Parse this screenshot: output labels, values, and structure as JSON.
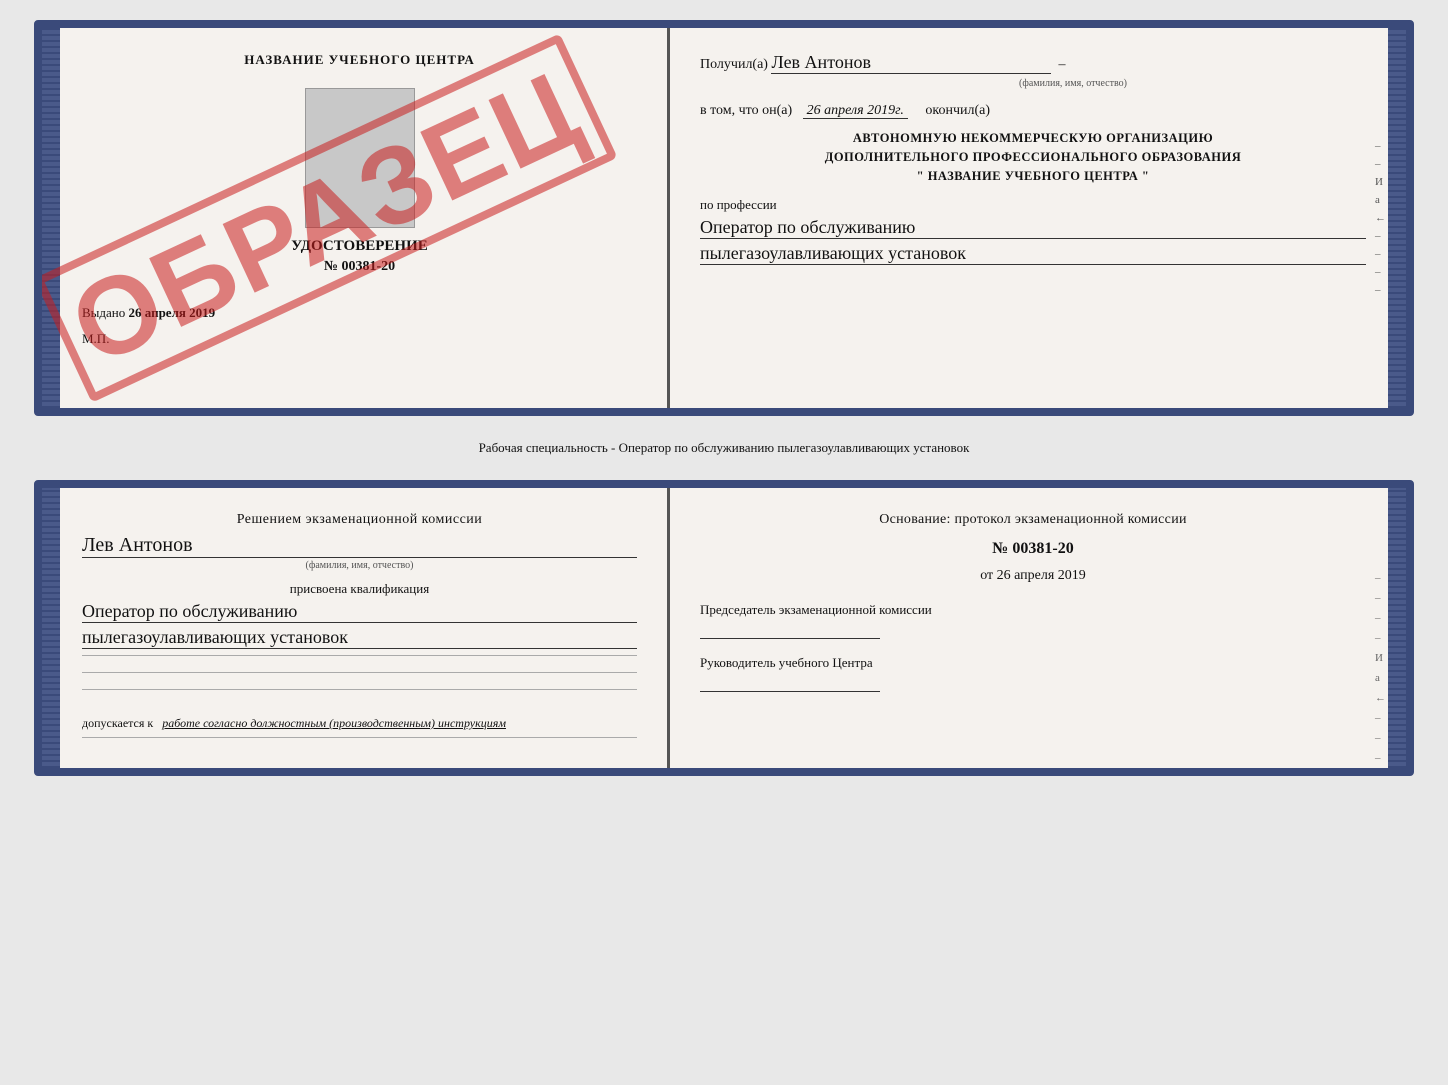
{
  "page": {
    "bg_color": "#e8e8e8"
  },
  "top_section": {
    "left": {
      "title": "НАЗВАНИЕ УЧЕБНОГО ЦЕНТРА",
      "watermark": "ОБРАЗЕЦ",
      "cert_title": "УДОСТОВЕРЕНИЕ",
      "cert_number": "№ 00381-20",
      "issued_label": "Выдано",
      "issued_date": "26 апреля 2019",
      "mp": "М.П."
    },
    "right": {
      "received_label": "Получил(а)",
      "received_name": "Лев Антонов",
      "fio_label": "(фамилия, имя, отчество)",
      "date_prefix": "в том, что он(а)",
      "date_value": "26 апреля 2019г.",
      "date_suffix": "окончил(а)",
      "org_line1": "АВТОНОМНУЮ НЕКОММЕРЧЕСКУЮ ОРГАНИЗАЦИЮ",
      "org_line2": "ДОПОЛНИТЕЛЬНОГО ПРОФЕССИОНАЛЬНОГО ОБРАЗОВАНИЯ",
      "org_line3": "\"   НАЗВАНИЕ УЧЕБНОГО ЦЕНТРА   \"",
      "profession_label": "по профессии",
      "profession_line1": "Оператор по обслуживанию",
      "profession_line2": "пылегазоулавливающих установок",
      "side_marks": [
        "–",
        "–",
        "И",
        "а",
        "←",
        "–",
        "–",
        "–",
        "–"
      ]
    }
  },
  "middle_text": "Рабочая специальность - Оператор по обслуживанию пылегазоулавливающих установок",
  "bottom_section": {
    "left": {
      "decision_title": "Решением экзаменационной комиссии",
      "person_name": "Лев Антонов",
      "fio_label": "(фамилия, имя, отчество)",
      "qualification_label": "присвоена квалификация",
      "qualification_line1": "Оператор по обслуживанию",
      "qualification_line2": "пылегазоулавливающих установок",
      "blank_lines": [
        "",
        "",
        ""
      ],
      "allowed_label": "допускается к",
      "allowed_value": "работе согласно должностным (производственным) инструкциям"
    },
    "right": {
      "foundation_label": "Основание: протокол экзаменационной комиссии",
      "protocol_number": "№  00381-20",
      "protocol_date_prefix": "от",
      "protocol_date": "26 апреля 2019",
      "chairman_label": "Председатель экзаменационной комиссии",
      "director_label": "Руководитель учебного Центра",
      "side_marks": [
        "–",
        "–",
        "–",
        "–",
        "И",
        "а",
        "←",
        "–",
        "–",
        "–",
        "–",
        "–"
      ]
    }
  }
}
